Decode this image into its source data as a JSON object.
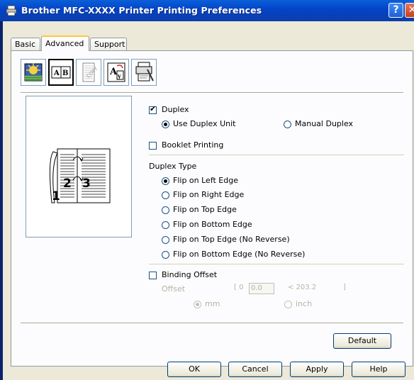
{
  "window": {
    "title": "Brother MFC-XXXX Printer Printing Preferences",
    "help_glyph": "?",
    "close_glyph": "✕"
  },
  "tabs": [
    {
      "label": "Basic",
      "active": false
    },
    {
      "label": "Advanced",
      "active": true
    },
    {
      "label": "Support",
      "active": false
    }
  ],
  "toolbar_icons": [
    "color-icon",
    "duplex-icon",
    "watermark-icon",
    "print-settings-icon",
    "device-options-icon"
  ],
  "duplex": {
    "checkbox_label": "Duplex",
    "checked": true,
    "use_unit_label": "Use Duplex Unit",
    "manual_label": "Manual Duplex",
    "selected": "Use Duplex Unit"
  },
  "booklet": {
    "label": "Booklet Printing",
    "checked": false
  },
  "duplex_type": {
    "heading": "Duplex Type",
    "options": [
      "Flip on Left Edge",
      "Flip on Right Edge",
      "Flip on Top Edge",
      "Flip on Bottom Edge",
      "Flip on Top Edge (No Reverse)",
      "Flip on Bottom Edge (No Reverse)"
    ],
    "selected": "Flip on Left Edge"
  },
  "binding": {
    "checkbox_label": "Binding Offset",
    "checked": false,
    "offset_label": "Offset",
    "range_prefix": "[ 0",
    "value": "0.0",
    "range_suffix": "< 203.2",
    "range_end": "]",
    "mm_label": "mm",
    "inch_label": "inch",
    "unit_selected": "mm"
  },
  "preview_pages": [
    "1",
    "2",
    "3"
  ],
  "buttons": {
    "default": "Default",
    "ok": "OK",
    "cancel": "Cancel",
    "apply": "Apply",
    "help": "Help"
  }
}
